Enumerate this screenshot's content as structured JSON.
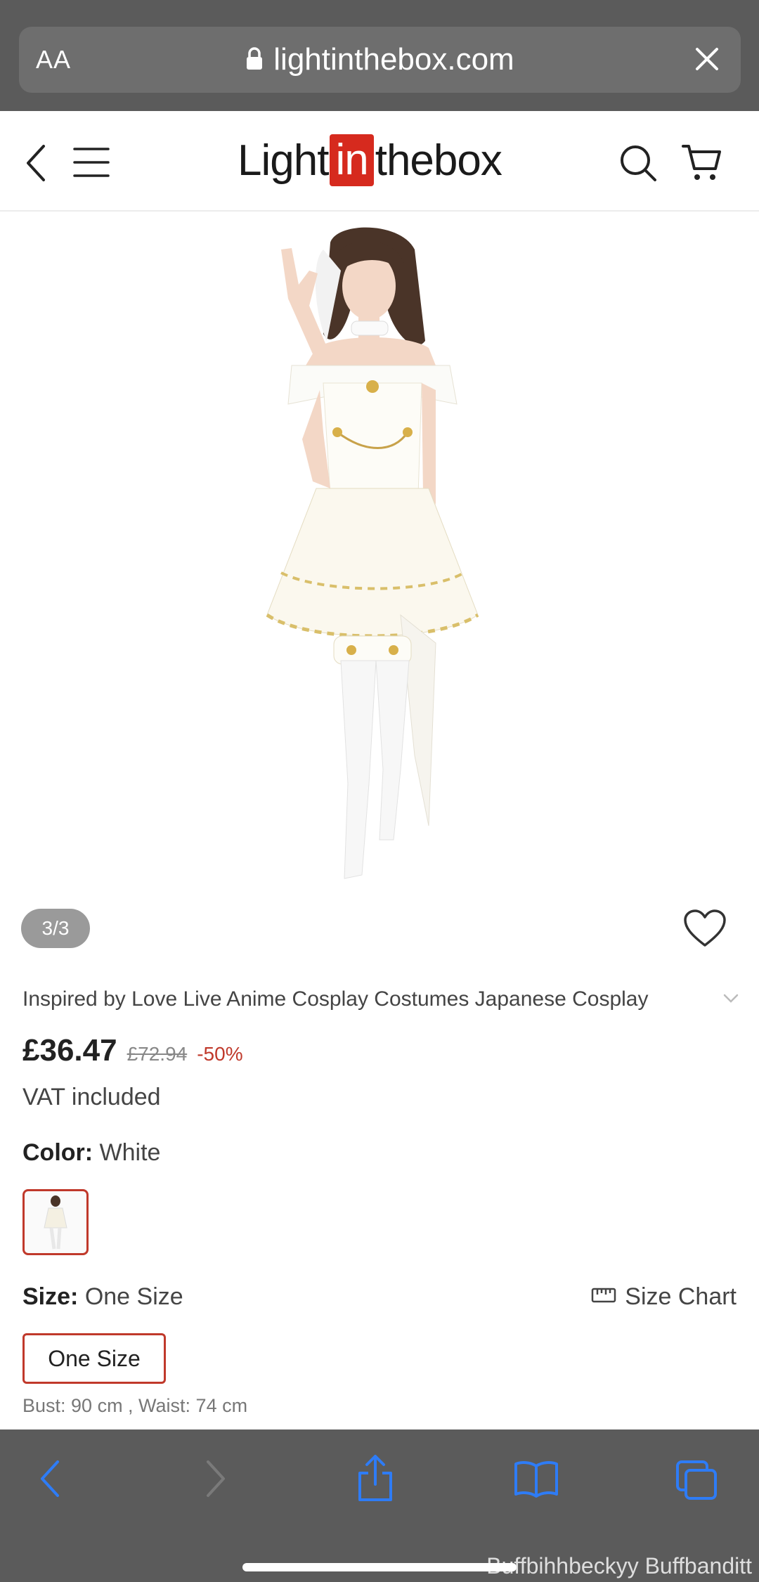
{
  "browser": {
    "aa_label": "AA",
    "url": "lightinthebox.com"
  },
  "site": {
    "logo_left": "Light",
    "logo_mid": "in",
    "logo_right": "thebox"
  },
  "gallery": {
    "counter": "3/3"
  },
  "product": {
    "title": "Inspired by Love Live Anime Cosplay Costumes Japanese Cosplay",
    "price": "£36.47",
    "original_price": "£72.94",
    "discount": "-50%",
    "vat_note": "VAT included",
    "color_label": "Color:",
    "color_value": "White",
    "size_label": "Size:",
    "size_value": "One Size",
    "size_chart_label": "Size Chart",
    "size_option": "One Size",
    "measurements": "Bust: 90 cm , Waist: 74 cm"
  },
  "watermark": "Buffbihhbeckyy Buffbanditt",
  "colors": {
    "accent": "#d62a1e",
    "safari_chrome": "#5b5b5b",
    "nav_icon": "#2e7cf6"
  },
  "icons": [
    "lock-icon",
    "close-icon",
    "back-icon",
    "menu-icon",
    "search-icon",
    "cart-icon",
    "heart-icon",
    "chevron-down-icon",
    "ruler-icon",
    "share-icon",
    "bookmarks-icon",
    "tabs-icon"
  ]
}
